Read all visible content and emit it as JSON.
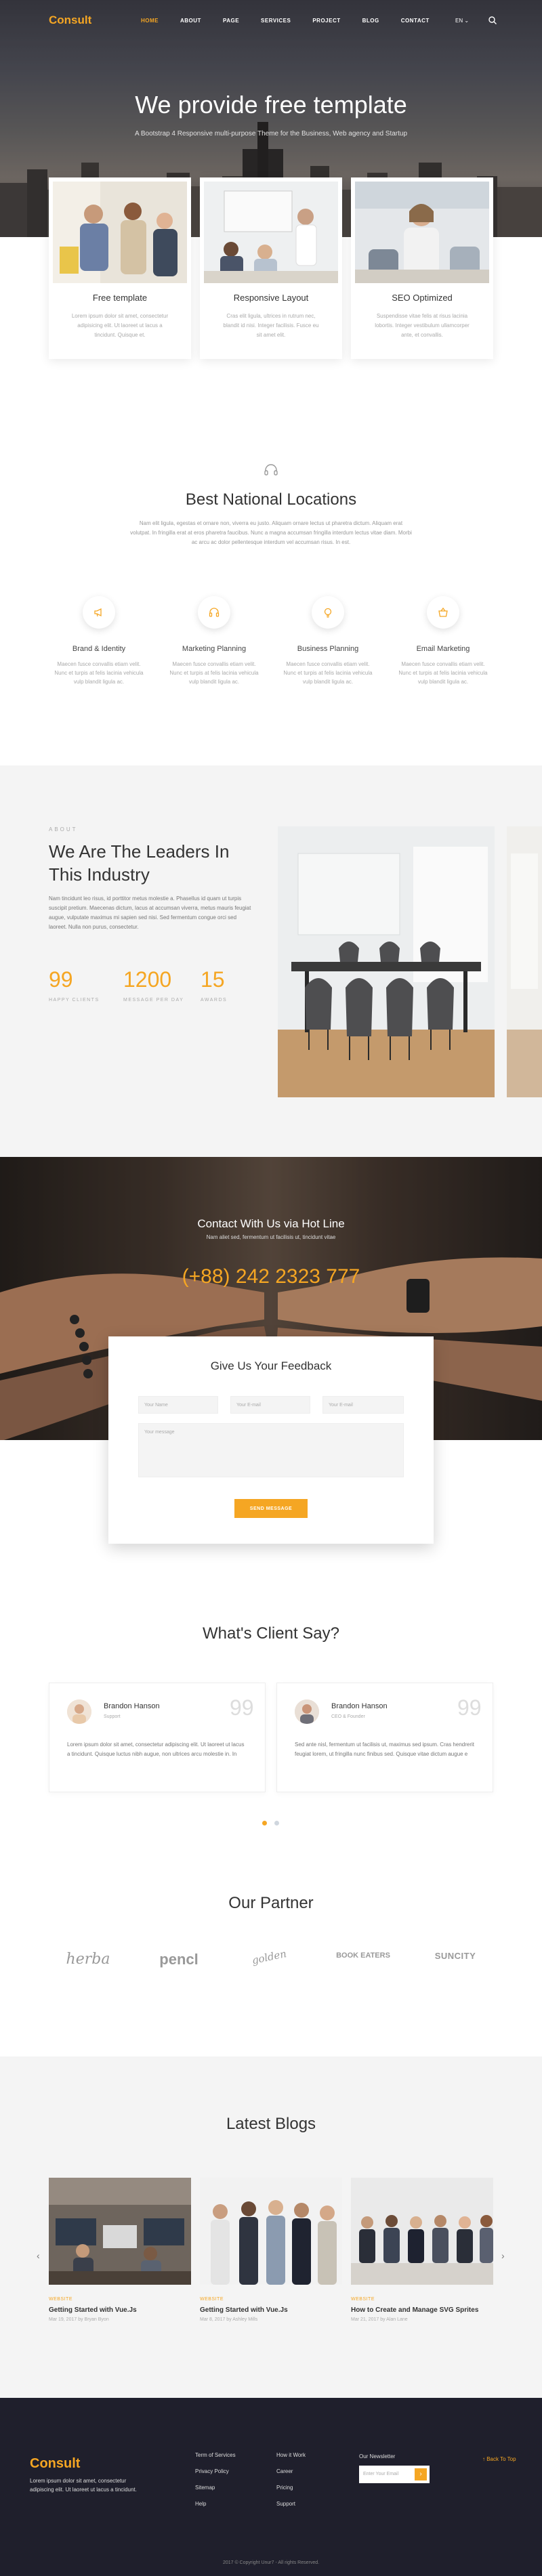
{
  "brand": {
    "logo": "Consult",
    "accent": "#f5a623"
  },
  "nav": {
    "items": [
      "HOME",
      "ABOUT",
      "PAGE",
      "SERVICES",
      "PROJECT",
      "BLOG",
      "CONTACT"
    ],
    "active": "HOME",
    "lang": "EN ⌄"
  },
  "hero": {
    "title": "We provide free template",
    "subtitle": "A Bootstrap 4 Responsive multi-purpose Theme for the Business, Web agency and Startup"
  },
  "services": [
    {
      "title": "Free template",
      "text": "Lorem ipsum dolor sit amet, consectetur adipisicing elit. Ut laoreet ut lacus a tincidunt. Quisque et."
    },
    {
      "title": "Responsive Layout",
      "text": "Cras elit ligula, ultrices in rutrum nec, blandit id nisi. Integer facilisis. Fusce eu sit amet elit."
    },
    {
      "title": "SEO Optimized",
      "text": "Suspendisse vitae felis at risus lacinia lobortis. Integer vestibulum ullamcorper ante, et convallis."
    }
  ],
  "locations": {
    "title": "Best National Locations",
    "description": "Nam elit ligula, egestas et ornare non, viverra eu justo. Aliquam ornare lectus ut pharetra dictum. Aliquam erat volutpat. In fringilla erat at eros pharetra faucibus. Nunc a magna accumsan fringilla interdum lectus vitae diam. Morbi ac arcu ac dolor pellentesque interdum vel accumsan risus. In est."
  },
  "features": [
    {
      "title": "Brand & Identity",
      "text": "Maecen fusce convallis etiam velit. Nunc et turpis at felis lacinia vehicula vulp blandit ligula ac.",
      "icon": "megaphone-icon"
    },
    {
      "title": "Marketing Planning",
      "text": "Maecen fusce convallis etiam velit. Nunc et turpis at felis lacinia vehicula vulp blandit ligula ac.",
      "icon": "headphones-icon"
    },
    {
      "title": "Business Planning",
      "text": "Maecen fusce convallis etiam velit. Nunc et turpis at felis lacinia vehicula vulp blandit ligula ac.",
      "icon": "lightbulb-icon"
    },
    {
      "title": "Email Marketing",
      "text": "Maecen fusce convallis etiam velit. Nunc et turpis at felis lacinia vehicula vulp blandit ligula ac.",
      "icon": "basket-icon"
    }
  ],
  "about": {
    "tag": "ABOUT",
    "title": "We Are The Leaders In This Industry",
    "text": "Nam tincidunt leo risus, id porttitor metus molestie a. Phasellus id quam ut turpis suscipit pretium. Maecenas dictum, lacus at accumsan viverra, metus mauris feugiat augue, vulputate maximus mi sapien sed nisi. Sed fermentum congue orci sed laoreet. Nulla non purus, consectetur.",
    "stats": [
      {
        "value": "99",
        "label": "HAPPY CLIENTS"
      },
      {
        "value": "1200",
        "label": "MESSAGE PER DAY"
      },
      {
        "value": "15",
        "label": "AWARDS"
      }
    ]
  },
  "contact": {
    "title": "Contact With Us via Hot Line",
    "subtitle": "Nam aliet sed, fermentum ut facilisis ut, tincidunt vitae",
    "phone": "(+88) 242 2323 777"
  },
  "feedback": {
    "title": "Give Us Your Feedback",
    "name_placeholder": "Your Name",
    "email_placeholder": "Your E-mail",
    "email2_placeholder": "Your E-mail",
    "message_placeholder": "Your message",
    "button": "SEND MESSAGE"
  },
  "testimonials": {
    "title": "What's Client Say?",
    "items": [
      {
        "name": "Brandon Hanson",
        "role": "Support",
        "quote": "99",
        "text": "Lorem ipsum dolor sit amet, consectetur adipiscing elit. Ut laoreet ut lacus a tincidunt. Quisque luctus nibh augue, non ultrices arcu molestie in. In"
      },
      {
        "name": "Brandon Hanson",
        "role": "CEO & Founder",
        "quote": "99",
        "text": "Sed ante nisl, fermentum ut facilisis ut, maximus sed ipsum. Cras hendrerit feugiat lorem, ut fringilla nunc finibus sed. Quisque vitae dictum augue e"
      }
    ]
  },
  "partners": {
    "title": "Our Partner",
    "items": [
      "herba",
      "pencl",
      "golden",
      "BOOK EATERS",
      "SUNCITY"
    ]
  },
  "blogs": {
    "title": "Latest Blogs",
    "items": [
      {
        "category": "WEBSITE",
        "title": "Getting Started with Vue.Js",
        "meta": "Mar 19, 2017  by Bryan Byon"
      },
      {
        "category": "WEBSITE",
        "title": "Getting Started with Vue.Js",
        "meta": "Mar 8, 2017  by Ashley Mills"
      },
      {
        "category": "WEBSITE",
        "title": "How to Create and Manage SVG Sprites",
        "meta": "Mar 21, 2017  by Alan Lane"
      }
    ]
  },
  "footer": {
    "logo": "Consult",
    "text": "Lorem ipsum dolor sit amet, consectetur adipiscing elit. Ut laoreet ut lacus a tincidunt.",
    "col1": [
      "Term of Services",
      "Privacy Policy",
      "Sitemap",
      "Help"
    ],
    "col2": [
      "How it Work",
      "Career",
      "Pricing",
      "Support"
    ],
    "newsletter_label": "Our Newsletter",
    "newsletter_placeholder": "Enter Your Email",
    "back_to_top": "↑ Back To Top",
    "copyright": "2017 © Copyright Unur7 - All rights Reserved."
  }
}
